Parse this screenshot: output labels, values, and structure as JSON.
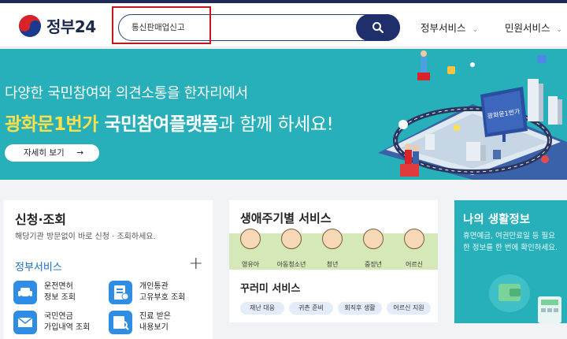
{
  "header": {
    "logo_text": "정부24",
    "search_value": "통신판매업신고",
    "nav": [
      {
        "label": "정부서비스"
      },
      {
        "label": "민원서비스"
      }
    ]
  },
  "banner": {
    "line1": "다양한 국민참여와 의견소통을 한자리에서",
    "line2_highlight": "광화문1번가",
    "line2_bold": " 국민참여플랫폼",
    "line2_rest": "과 함께 하세요!",
    "button_label": "자세히 보기",
    "button_arrow": "→",
    "sign_text": "광화문1번가"
  },
  "apply_card": {
    "title": "신청·조회",
    "desc": "해당기관 방문없이 바로 신청 · 조회하세요.",
    "section_title": "정부서비스",
    "plus": "+",
    "services": [
      {
        "line1": "운전면허",
        "line2": "정보 조회"
      },
      {
        "line1": "개인통관",
        "line2": "고유부호 조회"
      },
      {
        "line1": "국민연금",
        "line2": "가입내역 조회"
      },
      {
        "line1": "진료 받은",
        "line2": "내용보기"
      }
    ]
  },
  "life_card": {
    "title": "생애주기별 서비스",
    "stages": [
      "영유아",
      "아동청소년",
      "청년",
      "중장년",
      "어르신"
    ],
    "sub_title": "꾸러미 서비스",
    "tags": [
      "재난 대응",
      "귀촌 준비",
      "회직후 생활",
      "어르신 지원"
    ]
  },
  "my_card": {
    "title": "나의 생활정보",
    "desc": "휴면예금, 여권만료일 등 필요한 정보를 한 번에 확인하세요."
  },
  "colors": {
    "brand_navy": "#1e2f6b",
    "banner_teal": "#27b0ba",
    "highlight_yellow": "#ffe04a",
    "link_blue": "#1b6ec2",
    "search_highlight_red": "#c4161c"
  }
}
